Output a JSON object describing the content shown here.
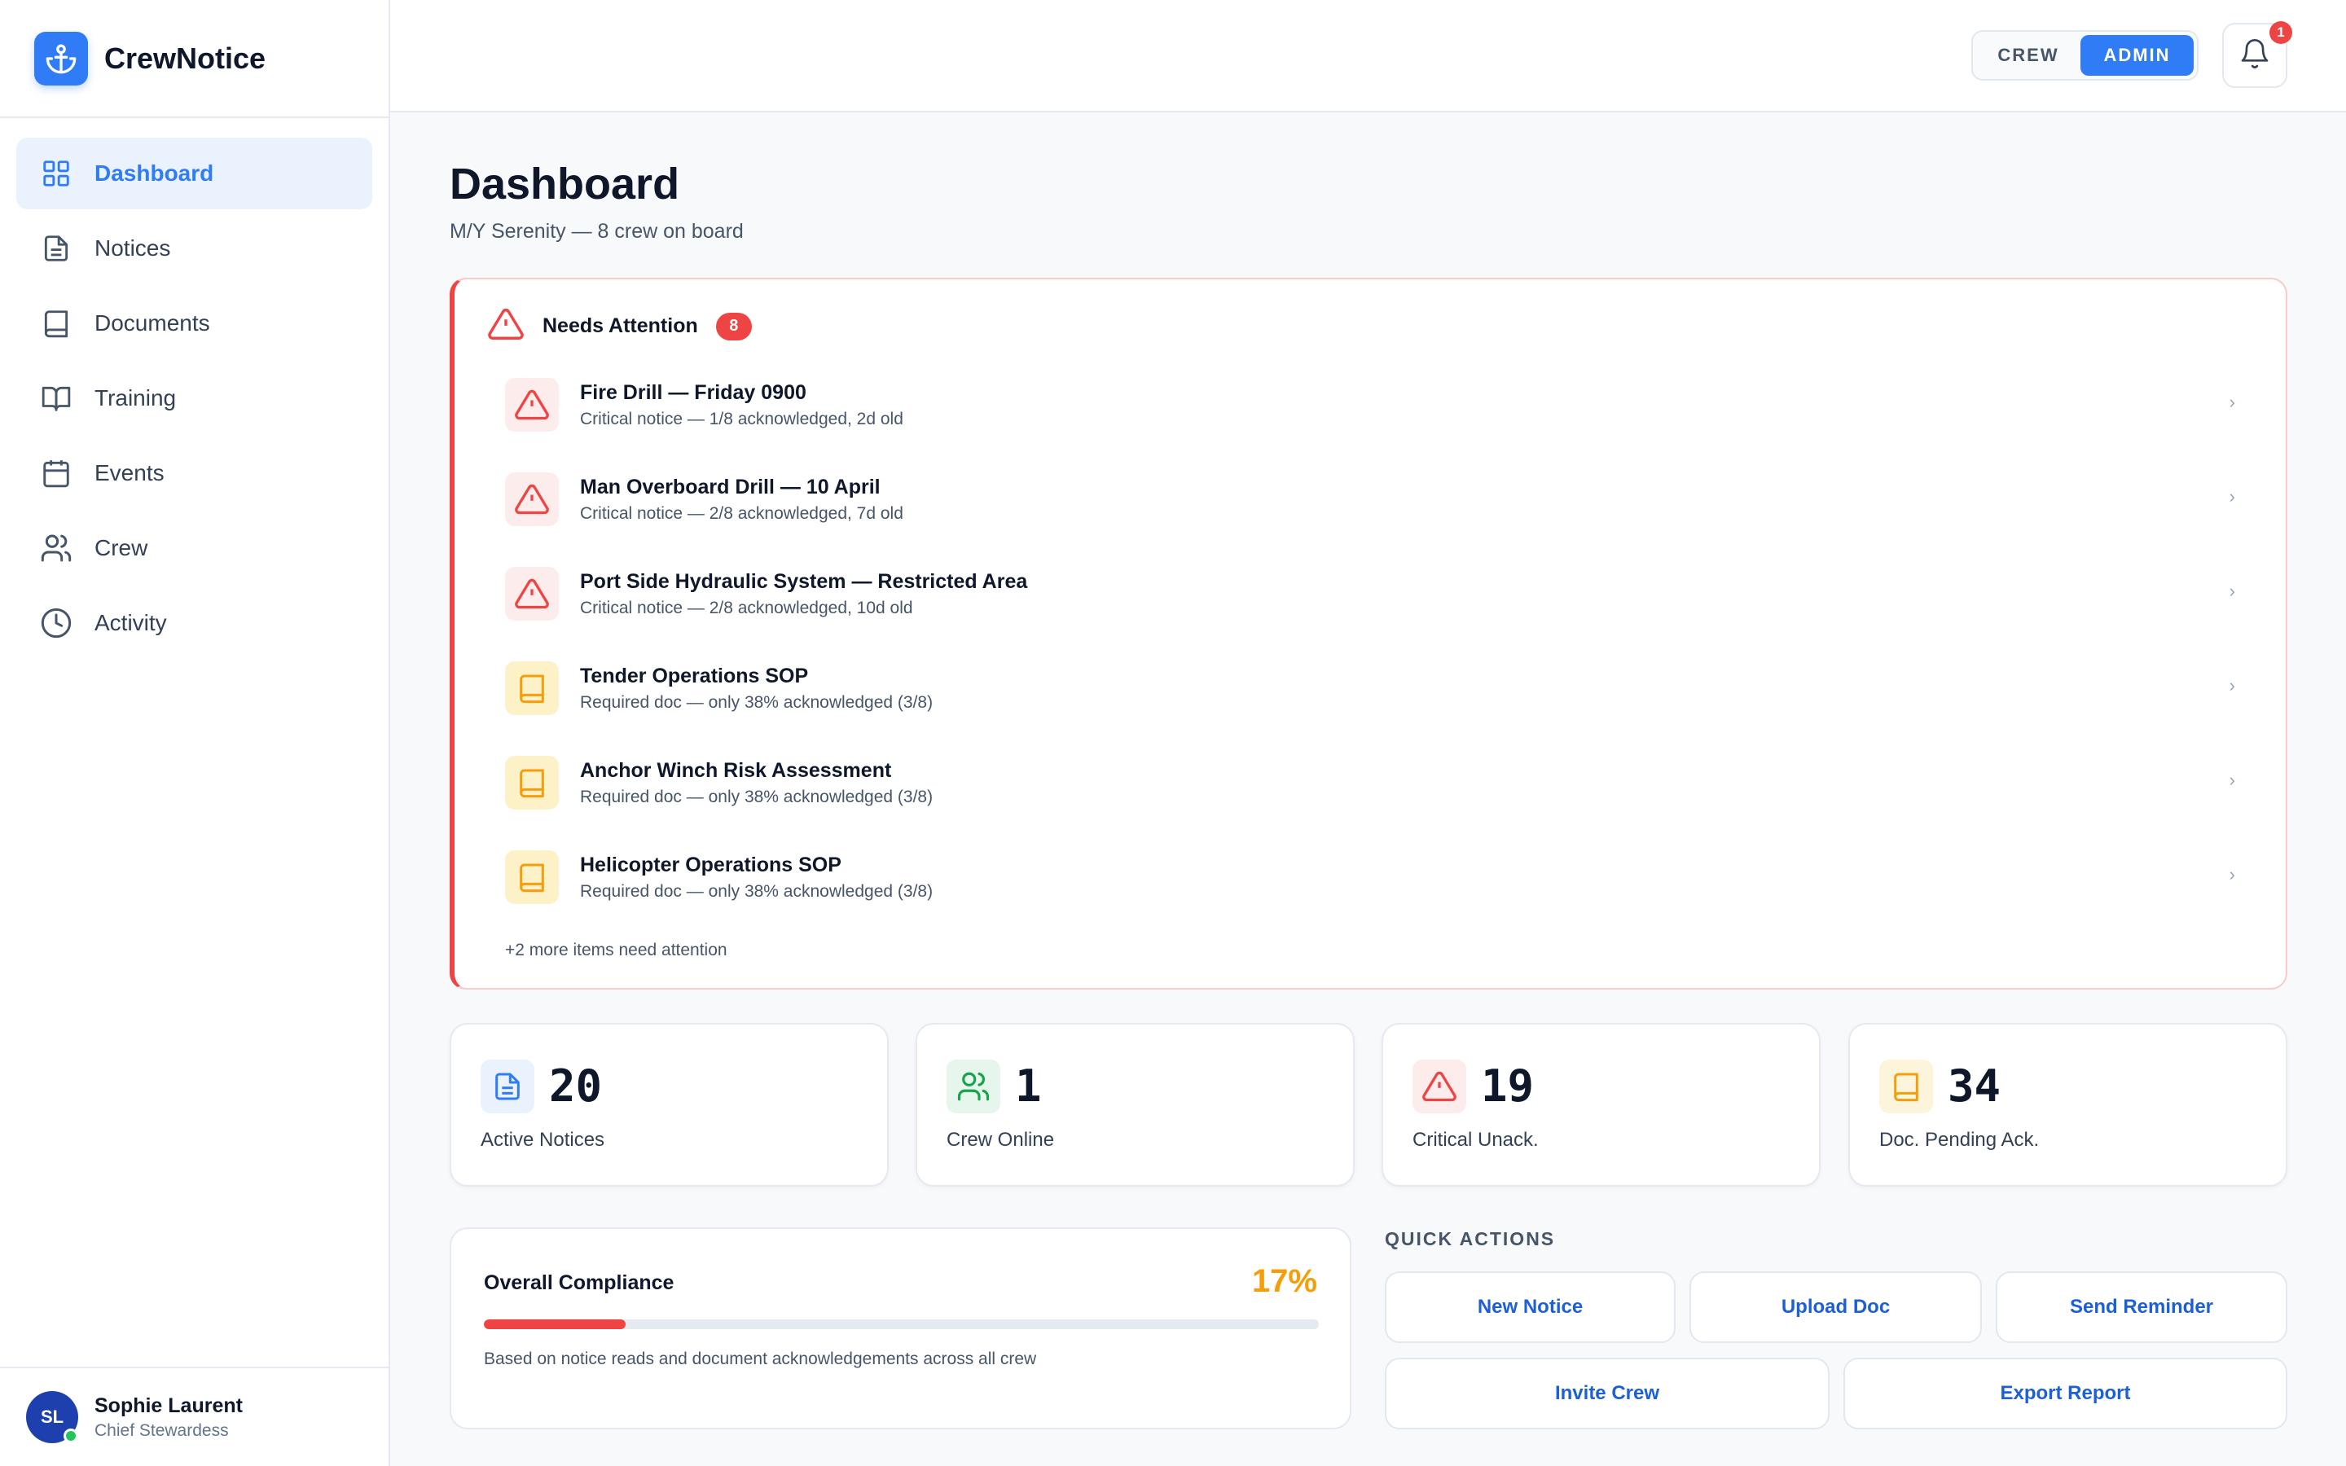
{
  "app": {
    "name": "CrewNotice"
  },
  "sidebar": {
    "items": [
      {
        "label": "Dashboard",
        "icon": "grid-icon",
        "active": true
      },
      {
        "label": "Notices",
        "icon": "document-icon"
      },
      {
        "label": "Documents",
        "icon": "book-icon"
      },
      {
        "label": "Training",
        "icon": "open-book-icon"
      },
      {
        "label": "Events",
        "icon": "calendar-icon"
      },
      {
        "label": "Crew",
        "icon": "users-icon"
      },
      {
        "label": "Activity",
        "icon": "clock-icon"
      }
    ],
    "user": {
      "initials": "SL",
      "name": "Sophie Laurent",
      "role": "Chief Stewardess",
      "status": "online"
    }
  },
  "topbar": {
    "role_toggle": {
      "options": [
        "CREW",
        "ADMIN"
      ],
      "selected": "ADMIN"
    },
    "notifications_count": "1"
  },
  "page": {
    "title": "Dashboard",
    "subtitle": "M/Y Serenity — 8 crew on board"
  },
  "attention": {
    "title": "Needs Attention",
    "count": "8",
    "items": [
      {
        "title": "Fire Drill — Friday 0900",
        "subtitle": "Critical notice — 1/8 acknowledged, 2d old",
        "kind": "critical"
      },
      {
        "title": "Man Overboard Drill — 10 April",
        "subtitle": "Critical notice — 2/8 acknowledged, 7d old",
        "kind": "critical"
      },
      {
        "title": "Port Side Hydraulic System — Restricted Area",
        "subtitle": "Critical notice — 2/8 acknowledged, 10d old",
        "kind": "critical"
      },
      {
        "title": "Tender Operations SOP",
        "subtitle": "Required doc — only 38% acknowledged (3/8)",
        "kind": "doc"
      },
      {
        "title": "Anchor Winch Risk Assessment",
        "subtitle": "Required doc — only 38% acknowledged (3/8)",
        "kind": "doc"
      },
      {
        "title": "Helicopter Operations SOP",
        "subtitle": "Required doc — only 38% acknowledged (3/8)",
        "kind": "doc"
      }
    ],
    "more": "+2 more items need attention"
  },
  "stats": [
    {
      "value": "20",
      "label": "Active Notices",
      "icon": "document-icon",
      "color": "#2f7cf6"
    },
    {
      "value": "1",
      "label": "Crew Online",
      "icon": "users-icon",
      "color": "#16a34a"
    },
    {
      "value": "19",
      "label": "Critical Unack.",
      "icon": "warning-icon",
      "color": "#ef4444"
    },
    {
      "value": "34",
      "label": "Doc. Pending Ack.",
      "icon": "book-icon",
      "color": "#f59e0b"
    }
  ],
  "compliance": {
    "title": "Overall Compliance",
    "percent_label": "17%",
    "percent": 17,
    "note": "Based on notice reads and document acknowledgements across all crew"
  },
  "quick_actions": {
    "title": "QUICK ACTIONS",
    "buttons": [
      "New Notice",
      "Upload Doc",
      "Send Reminder",
      "Invite Crew",
      "Export Report"
    ]
  },
  "colors": {
    "accent": "#2f7cf6",
    "danger": "#ef4444",
    "warning": "#f59e0b",
    "success": "#16a34a"
  }
}
